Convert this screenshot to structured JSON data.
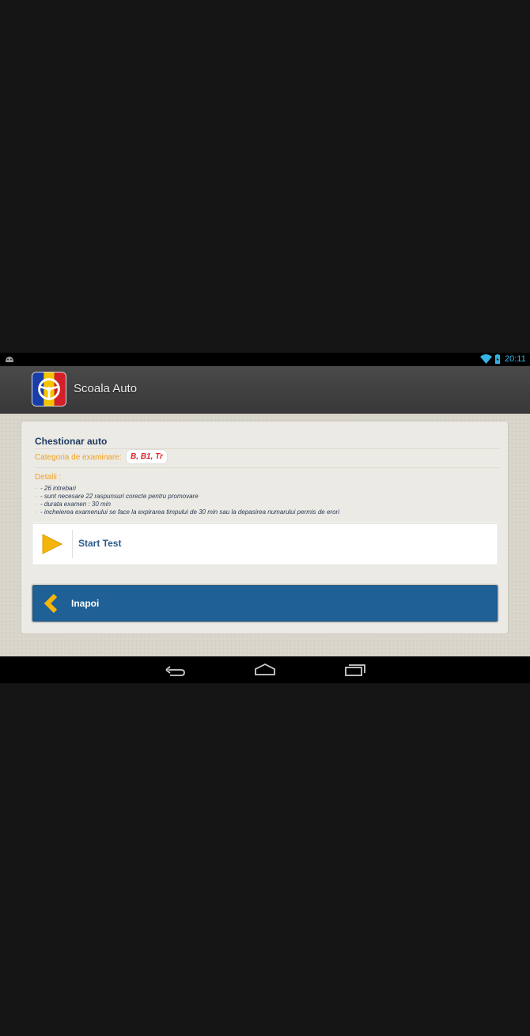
{
  "status_bar": {
    "time": "20:11",
    "icons": [
      "android-icon",
      "wifi-icon",
      "battery-icon"
    ],
    "accent_color": "#33b5e5"
  },
  "action_bar": {
    "app_title": "Scoala Auto",
    "logo_icon": "steering-wheel-icon"
  },
  "test": {
    "title": "Chestionar auto",
    "category_label": "Categoria de examinare:",
    "category_value": "B, B1, Tr",
    "details_label": "Detalii :",
    "details": [
      "- 26 intrebari",
      "- sunt necesare 22 raspunsuri corecte pentru promovare",
      "- durata examen : 30 min",
      "- incheierea examenului se face la expirarea timpului de 30 min sau la depasirea numarului permis de erori"
    ]
  },
  "buttons": {
    "start_label": "Start Test",
    "back_label": "Inapoi"
  },
  "colors": {
    "accent_orange": "#f0a020",
    "back_button": "#1f6096",
    "title_blue": "#1e3a63",
    "badge_red": "#d8262a"
  },
  "nav_bar": {
    "icons": [
      "back-icon",
      "home-icon",
      "recent-apps-icon"
    ]
  }
}
